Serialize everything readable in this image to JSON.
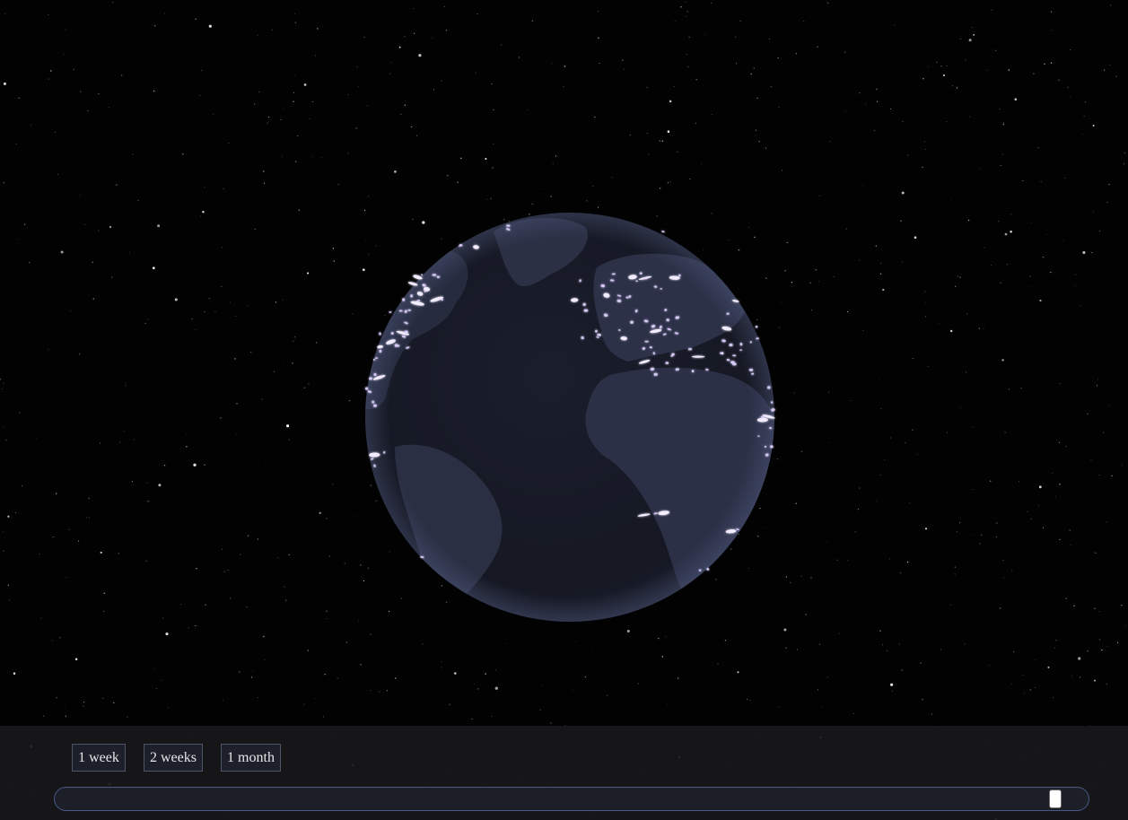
{
  "controls": {
    "range_buttons": [
      {
        "label": "1 week"
      },
      {
        "label": "2 weeks"
      },
      {
        "label": "1 month"
      }
    ],
    "timeline": {
      "position_fraction": 0.975
    }
  },
  "colors": {
    "space_background": "#020203",
    "ocean": "#171a25",
    "land": "#2a2f44",
    "activity_glow": "#e8d8ff",
    "panel_background": "#18181b",
    "button_border": "#4e5566",
    "track_border": "#4a5a86"
  }
}
